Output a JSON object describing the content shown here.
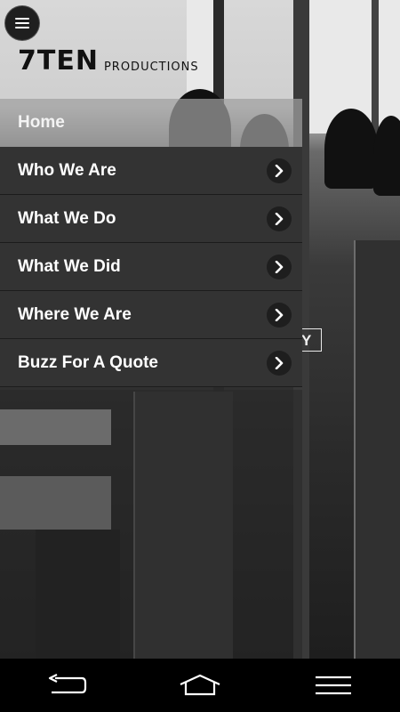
{
  "logo": {
    "mark": "7TEN",
    "sub": "PRODUCTIONS"
  },
  "background": {
    "partial_label": "Y"
  },
  "menu": {
    "items": [
      {
        "label": "Home",
        "active": true
      },
      {
        "label": "Who We Are",
        "active": false
      },
      {
        "label": "What We Do",
        "active": false
      },
      {
        "label": "What We Did",
        "active": false
      },
      {
        "label": "Where We Are",
        "active": false
      },
      {
        "label": "Buzz For A Quote",
        "active": false
      }
    ]
  },
  "icons": {
    "menu": "hamburger-icon",
    "chevron": "chevron-right-icon",
    "back": "back-icon",
    "home": "home-icon",
    "recent": "recent-apps-icon"
  },
  "colors": {
    "drawer_bg": "#333333",
    "home_bg": "#a0a0a0",
    "navbar_bg": "#000000"
  }
}
